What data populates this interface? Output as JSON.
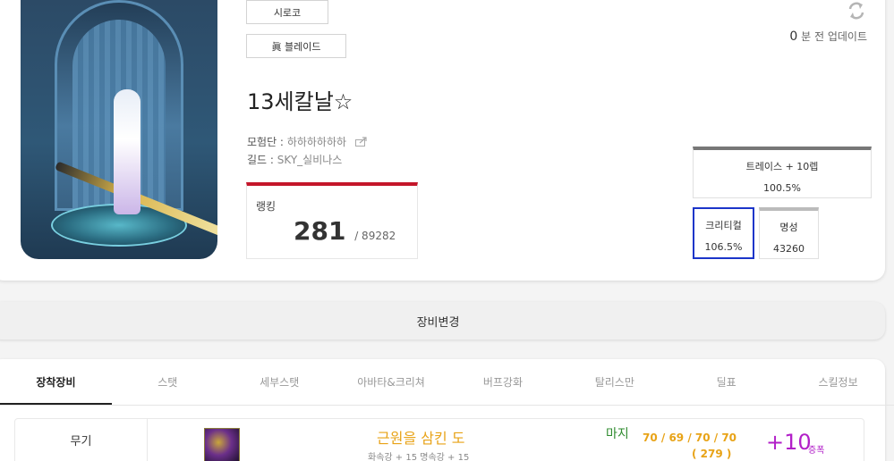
{
  "profile": {
    "server": "시로코",
    "class": "眞 블레이드",
    "name": "13세칼날☆",
    "adventure_label": "모험단 :",
    "adventure_value": "하하하하하하",
    "guild_label": "길드 :",
    "guild_value": "SKY_실비나스"
  },
  "ranking": {
    "label": "랭킹",
    "value": "281",
    "total": "/ 89282",
    "accent_color": "#c4162a"
  },
  "update": {
    "minutes": "0",
    "suffix": "분 전 업데이트"
  },
  "stats": {
    "trace": {
      "label": "트레이스 + 10렙",
      "value": "100.5%"
    },
    "critical": {
      "label": "크리티컬",
      "value": "106.5%",
      "border_color": "#1b35c9"
    },
    "fame": {
      "label": "명성",
      "value": "43260"
    }
  },
  "equip_change": {
    "label": "장비변경"
  },
  "tabs": [
    {
      "label": "장착장비"
    },
    {
      "label": "스탯"
    },
    {
      "label": "세부스탯"
    },
    {
      "label": "아바타&크리쳐"
    },
    {
      "label": "버프강화"
    },
    {
      "label": "탈리스만"
    },
    {
      "label": "딜표"
    },
    {
      "label": "스킬정보"
    }
  ],
  "equipment": [
    {
      "slot": "무기",
      "name": "근원을 삼킨 도",
      "sub": "화속강 + 15 명속강 + 15",
      "element": "마지",
      "stats": "70 / 69 / 70 / 70",
      "stats_total": "( 279 )",
      "reinforce": "+10",
      "reinforce_type": "증폭",
      "icon": "weapon-item-icon"
    }
  ],
  "icons": {
    "refresh": "refresh-icon",
    "share": "share-icon"
  }
}
